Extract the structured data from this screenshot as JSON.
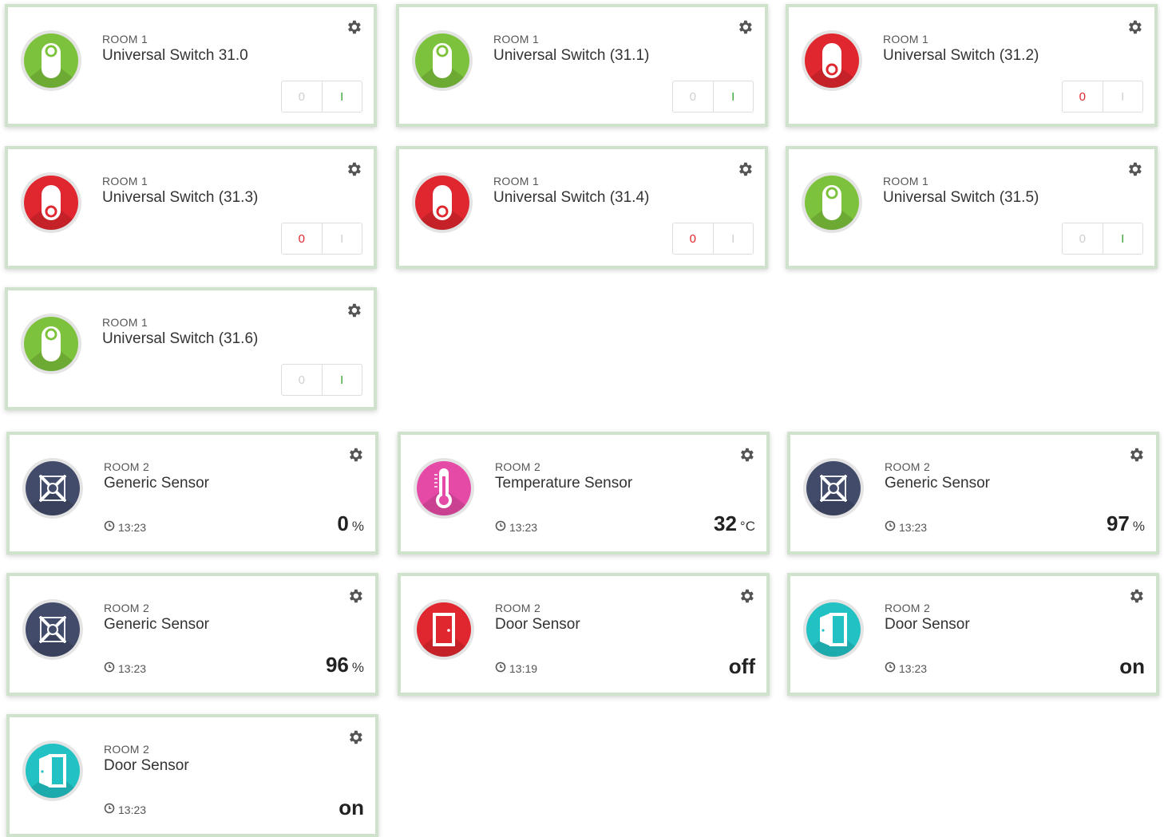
{
  "colors": {
    "green": "#7dc23c",
    "red": "#e0262f",
    "navy": "#434b6a",
    "pink": "#e64aa7",
    "teal": "#22c2c4",
    "off_label": "#e0262f",
    "on_label": "#3aa63a"
  },
  "switches": [
    {
      "room": "ROOM 1",
      "title": "Universal Switch 31.0",
      "state": "on",
      "off_label": "0",
      "on_label": "I"
    },
    {
      "room": "ROOM 1",
      "title": "Universal Switch (31.1)",
      "state": "on",
      "off_label": "0",
      "on_label": "I"
    },
    {
      "room": "ROOM 1",
      "title": "Universal Switch (31.2)",
      "state": "off",
      "off_label": "0",
      "on_label": "I"
    },
    {
      "room": "ROOM 1",
      "title": "Universal Switch (31.3)",
      "state": "off",
      "off_label": "0",
      "on_label": "I"
    },
    {
      "room": "ROOM 1",
      "title": "Universal Switch (31.4)",
      "state": "off",
      "off_label": "0",
      "on_label": "I"
    },
    {
      "room": "ROOM 1",
      "title": "Universal Switch (31.5)",
      "state": "on",
      "off_label": "0",
      "on_label": "I"
    },
    {
      "room": "ROOM 1",
      "title": "Universal Switch (31.6)",
      "state": "on",
      "off_label": "0",
      "on_label": "I"
    }
  ],
  "sensors": [
    {
      "room": "ROOM 2",
      "title": "Generic Sensor",
      "icon": "generic-sensor-icon",
      "time": "13:23",
      "value": "0",
      "unit": "%"
    },
    {
      "room": "ROOM 2",
      "title": "Temperature Sensor",
      "icon": "thermometer-icon",
      "time": "13:23",
      "value": "32",
      "unit": "°C"
    },
    {
      "room": "ROOM 2",
      "title": "Generic Sensor",
      "icon": "generic-sensor-icon",
      "time": "13:23",
      "value": "97",
      "unit": "%"
    },
    {
      "room": "ROOM 2",
      "title": "Generic Sensor",
      "icon": "generic-sensor-icon",
      "time": "13:23",
      "value": "96",
      "unit": "%"
    },
    {
      "room": "ROOM 2",
      "title": "Door Sensor",
      "icon": "door-closed-icon",
      "time": "13:19",
      "value": "off",
      "unit": ""
    },
    {
      "room": "ROOM 2",
      "title": "Door Sensor",
      "icon": "door-open-icon",
      "time": "13:23",
      "value": "on",
      "unit": ""
    },
    {
      "room": "ROOM 2",
      "title": "Door Sensor",
      "icon": "door-open-icon",
      "time": "13:23",
      "value": "on",
      "unit": ""
    }
  ]
}
